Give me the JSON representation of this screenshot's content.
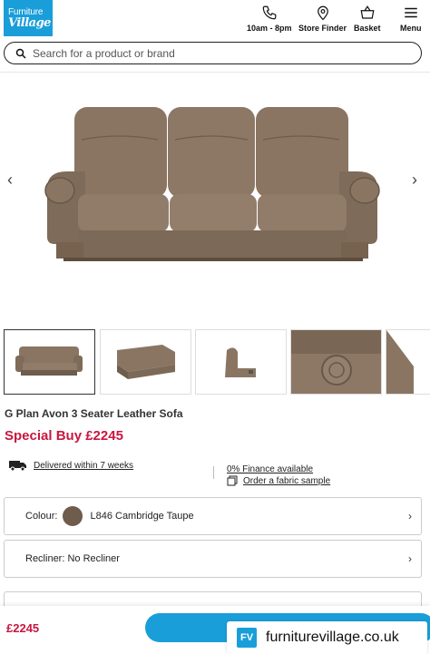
{
  "header": {
    "logo_line1": "Furniture",
    "logo_line2": "Village",
    "hours_label": "10am - 8pm",
    "store_label": "Store Finder",
    "basket_label": "Basket",
    "menu_label": "Menu"
  },
  "search": {
    "placeholder": "Search for a product or brand"
  },
  "product": {
    "title": "G Plan Avon 3 Seater Leather Sofa",
    "price": "Special Buy £2245",
    "delivery": "Delivered within 7 weeks",
    "finance": "0% Finance available",
    "sample": "Order a fabric sample",
    "colour_label": "Colour:",
    "colour_value": "L846 Cambridge Taupe",
    "colour_hex": "#6e5c4c",
    "recliner": "Recliner: No Recliner"
  },
  "bottom": {
    "price": "£2245"
  },
  "watermark": {
    "badge": "FV",
    "site": "furniturevillage.co.uk"
  },
  "colors": {
    "brand_blue": "#1a9ed9",
    "price_red": "#c8173f",
    "leather": "#8a7563"
  }
}
